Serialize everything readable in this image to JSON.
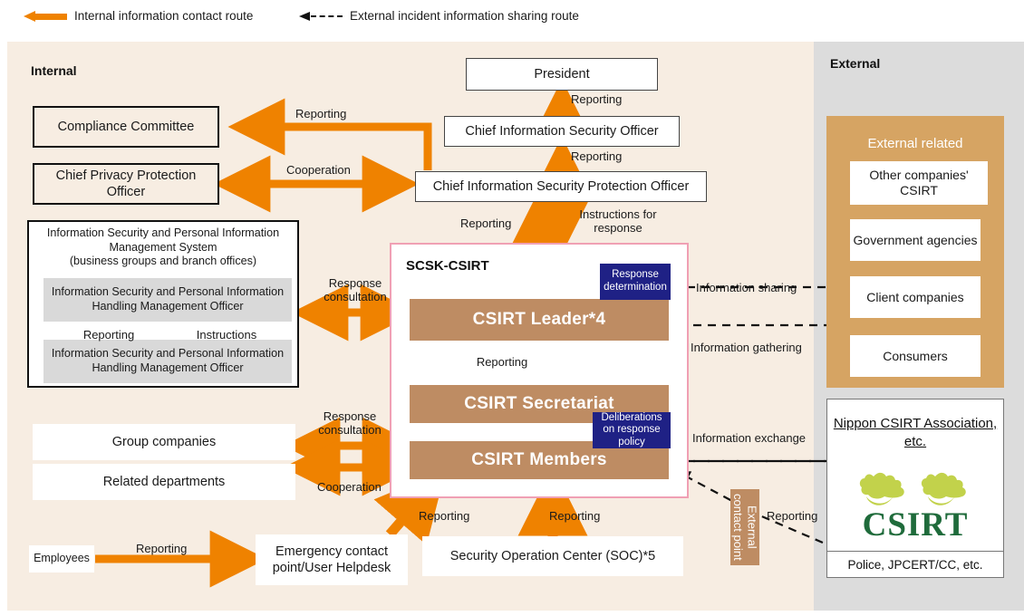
{
  "legend": {
    "solid": "Internal information contact route",
    "dashed": "External incident information sharing route"
  },
  "panels": {
    "internal_label": "Internal",
    "external_label": "External"
  },
  "colors": {
    "orange": "#EF8200",
    "internal_bg": "#F7EDE2",
    "external_bg": "#DCDCDC",
    "csirt_band": "#BE8C63",
    "badge_navy": "#1F2185",
    "ext_group": "#D6A463",
    "csirt_frame": "#F0A0B4",
    "logo_green_dark": "#1F6B3B",
    "logo_green_light": "#C2D24B"
  },
  "internal": {
    "president": "President",
    "ciso": "Chief Information Security Officer",
    "cispo": "Chief Information Security Protection Officer",
    "compliance_committee": "Compliance Committee",
    "chief_privacy": "Chief Privacy Protection Officer",
    "isms": {
      "title_line1": "Information Security and Personal Information",
      "title_line2": "Management System",
      "title_line3": "(business groups and branch offices)",
      "officer_upper": "Information Security and Personal Information Handling Management Officer",
      "officer_lower": "Information Security and Personal Information Handling Management Officer",
      "reporting": "Reporting",
      "instructions": "Instructions"
    },
    "group_companies": "Group companies",
    "related_departments": "Related departments",
    "employees": "Employees",
    "emergency_contact": "Emergency contact point/User Helpdesk",
    "soc": "Security Operation Center (SOC)*5"
  },
  "csirt": {
    "title": "SCSK-CSIRT",
    "leader": "CSIRT Leader*4",
    "secretariat": "CSIRT Secretariat",
    "members": "CSIRT Members",
    "badge_response": "Response determination",
    "badge_deliberations": "Deliberations on response policy",
    "reporting_internal": "Reporting"
  },
  "external": {
    "group_title": "External related",
    "items": [
      "Other companies' CSIRT",
      "Government agencies",
      "Client companies",
      "Consumers"
    ],
    "nippon_title": "Nippon CSIRT Association, etc.",
    "nippon_logo_text": "CSIRT",
    "police": "Police, JPCERT/CC, etc.",
    "contact_point": "External contact point"
  },
  "edge_labels": {
    "reporting_president": "Reporting",
    "reporting_ciso": "Reporting",
    "reporting_compliance": "Reporting",
    "cooperation_privacy": "Cooperation",
    "reporting_cispo": "Reporting",
    "instructions_for_response": "Instructions for response",
    "response_consultation_isms": "Response consultation",
    "response_consultation_group": "Response consultation",
    "cooperation_related": "Cooperation",
    "reporting_employees": "Reporting",
    "reporting_helpdesk": "Reporting",
    "reporting_soc": "Reporting",
    "information_sharing": "Information sharing",
    "information_gathering": "Information gathering",
    "information_exchange": "Information exchange",
    "reporting_police": "Reporting"
  }
}
